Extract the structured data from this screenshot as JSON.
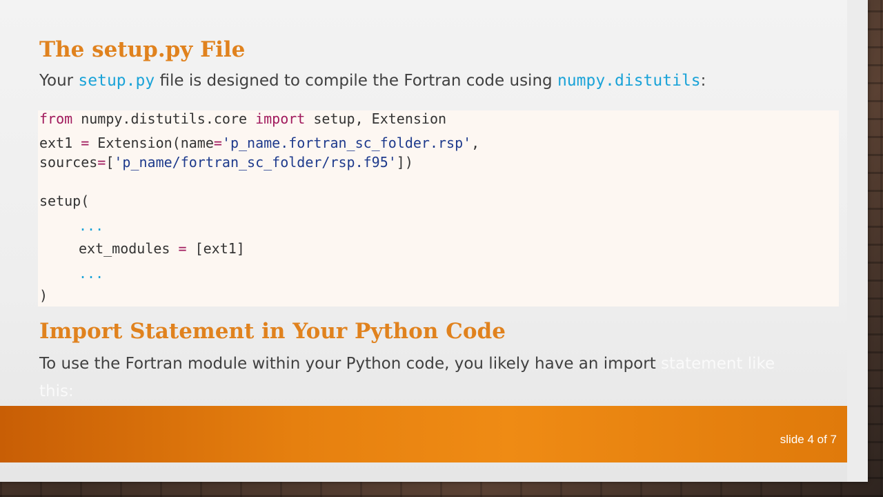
{
  "heading1": "The setup.py File",
  "intro": {
    "part1": "Your ",
    "code1": "setup.py",
    "part2": " file is designed to compile the Fortran code using ",
    "code2": "numpy.distutils",
    "part3": ":"
  },
  "code": {
    "l1_from": "from",
    "l1_mid": " numpy.distutils.core ",
    "l1_import": "import",
    "l1_end": " setup, Extension",
    "l2_a": "ext1 ",
    "l2_eq": "=",
    "l2_b": " Extension(name",
    "l2_eq2": "=",
    "l2_str": "'p_name.fortran_sc_folder.rsp'",
    "l2_c": ",",
    "l3_a": "sources",
    "l3_eq": "=",
    "l3_b": "[",
    "l3_str": "'p_name/fortran_sc_folder/rsp.f95'",
    "l3_c": "])",
    "l4": "setup(",
    "l5": "...",
    "l6_a": "ext_modules ",
    "l6_eq": "=",
    "l6_b": " [ext1]",
    "l7": "...",
    "l8": ")"
  },
  "heading2": "Import Statement in Your Python Code",
  "para2": {
    "visible": "To use the Fortran module within your Python code, you likely have an import ",
    "faded": "statement like",
    "faded2": "this:"
  },
  "footer": {
    "slide_num": "slide 4 of 7"
  },
  "colors": {
    "accent": "#e0821e",
    "inline_code": "#1aa3d8",
    "keyword": "#a0195c",
    "string": "#1e3a8c"
  }
}
